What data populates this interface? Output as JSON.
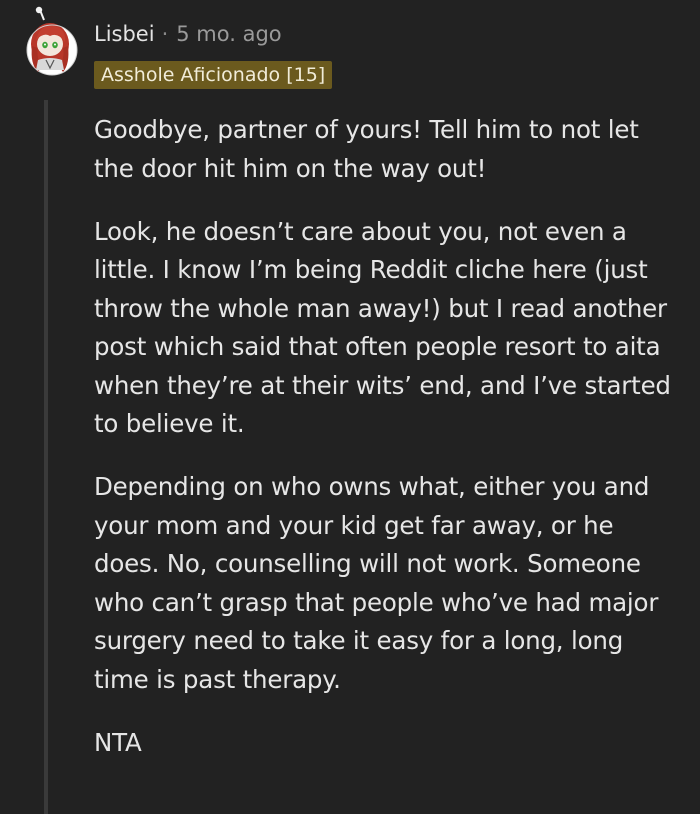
{
  "comment": {
    "username": "Lisbei",
    "separator": "·",
    "timestamp": "5 mo. ago",
    "flair": "Asshole Aficionado [15]",
    "avatar_icon": "snoo-avatar-icon",
    "paragraphs": [
      "Goodbye, partner of yours! Tell him to not let the door hit him on the way out!",
      "Look, he doesn’t care about you, not even a little. I know I’m being Reddit cliche here (just throw the whole man away!) but I read another post which said that often people resort to aita when they’re at their wits’ end, and I’ve started to believe it.",
      "Depending on who owns what, either you and your mom and your kid get far away, or he does. No, counselling will not work. Someone who can’t grasp that people who’ve had major surgery need to take it easy for a long, long time is past therapy.",
      "NTA"
    ]
  },
  "colors": {
    "background": "#222222",
    "flair_bg": "#6b5a1e",
    "thread_line": "#3a3a3a"
  }
}
